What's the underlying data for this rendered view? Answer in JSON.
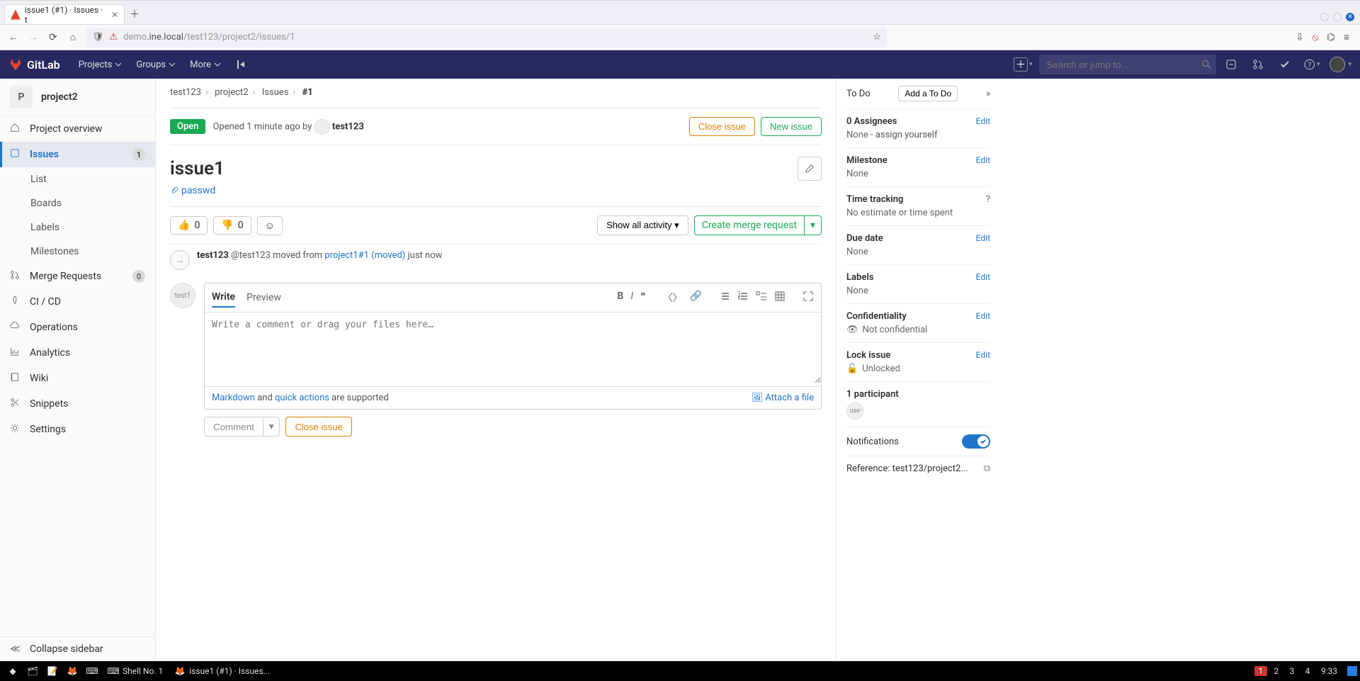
{
  "browser": {
    "tab_title": "issue1 (#1) · Issues · t",
    "url_prefix": "demo",
    "url_host": ".ine.local",
    "url_path": "/test123/project2/issues/1"
  },
  "gitlab_header": {
    "brand": "GitLab",
    "menu": {
      "projects": "Projects",
      "groups": "Groups",
      "more": "More"
    },
    "search_placeholder": "Search or jump to..."
  },
  "sidebar": {
    "project_letter": "P",
    "project_name": "project2",
    "items": [
      {
        "label": "Project overview"
      },
      {
        "label": "Issues",
        "count": "1"
      },
      {
        "label": "Merge Requests",
        "count": "0"
      },
      {
        "label": "CI / CD"
      },
      {
        "label": "Operations"
      },
      {
        "label": "Analytics"
      },
      {
        "label": "Wiki"
      },
      {
        "label": "Snippets"
      },
      {
        "label": "Settings"
      }
    ],
    "issues_sub": [
      "List",
      "Boards",
      "Labels",
      "Milestones"
    ],
    "collapse": "Collapse sidebar"
  },
  "crumbs": {
    "a": "test123",
    "b": "project2",
    "c": "Issues",
    "cur": "#1"
  },
  "issue": {
    "state": "Open",
    "opened": "Opened 1 minute ago by",
    "author": "test123",
    "close_btn": "Close issue",
    "new_btn": "New issue",
    "title": "issue1",
    "attachment": "passwd",
    "thumbs_up": "0",
    "thumbs_down": "0",
    "show_activity": "Show all activity",
    "create_mr": "Create merge request"
  },
  "activity": {
    "user": "test123",
    "handle": "@test123",
    "verb": "moved from",
    "link": "project1#1 (moved)",
    "when": "just now"
  },
  "comment": {
    "avatar_label": "test1",
    "tab_write": "Write",
    "tab_preview": "Preview",
    "placeholder": "Write a comment or drag your files here…",
    "markdown_link": "Markdown",
    "and": " and ",
    "quick_link": "quick actions",
    "supported": " are supported",
    "attach": "Attach a file",
    "comment_btn": "Comment",
    "close_btn": "Close issue"
  },
  "rside": {
    "todo": "To Do",
    "add_todo": "Add a To Do",
    "assignees_hdr": "0 Assignees",
    "assignees_val_a": "None - ",
    "assignees_val_b": "assign yourself",
    "milestone": "Milestone",
    "milestone_val": "None",
    "time": "Time tracking",
    "time_val": "No estimate or time spent",
    "due": "Due date",
    "due_val": "None",
    "labels": "Labels",
    "labels_val": "None",
    "conf": "Confidentiality",
    "conf_val": "Not confidential",
    "lock": "Lock issue",
    "lock_val": "Unlocked",
    "participants": "1 participant",
    "part_label": "use",
    "notifications": "Notifications",
    "reference": "Reference: test123/project2...",
    "edit": "Edit"
  },
  "taskbar": {
    "shell": "Shell No. 1",
    "firefox": "issue1 (#1) · Issues...",
    "ws": [
      "1",
      "2",
      "3",
      "4"
    ],
    "clock": "9:33"
  }
}
